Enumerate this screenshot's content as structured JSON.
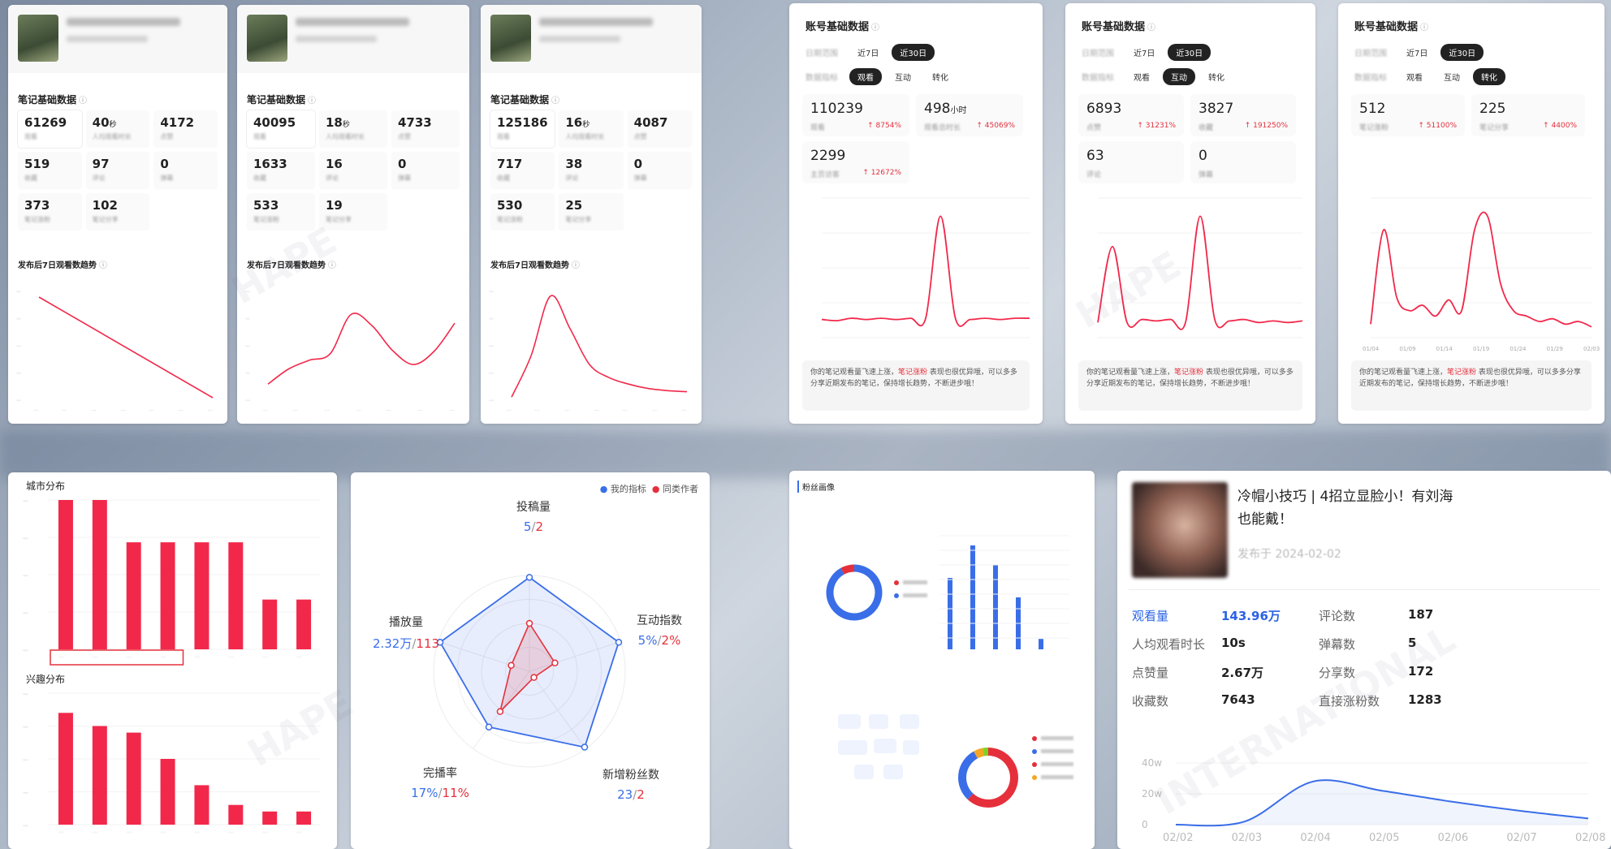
{
  "colors": {
    "accent_red": "#f2284a",
    "accent_blue": "#3a6ee8",
    "dark_pill": "#222222",
    "up_red": "#e5303c"
  },
  "watermark": {
    "line1": "HAPE",
    "line2": "INTERNATIONAL"
  },
  "note_cards": [
    {
      "section_title": "笔记基础数据",
      "metrics": [
        {
          "value": "61269",
          "unit": "",
          "label": "观看"
        },
        {
          "value": "40",
          "unit": "秒",
          "label": "人均观看时长"
        },
        {
          "value": "4172",
          "unit": "",
          "label": "点赞"
        },
        {
          "value": "519",
          "unit": "",
          "label": "收藏"
        },
        {
          "value": "97",
          "unit": "",
          "label": "评论"
        },
        {
          "value": "0",
          "unit": "",
          "label": "弹幕"
        },
        {
          "value": "373",
          "unit": "",
          "label": "笔记涨粉"
        },
        {
          "value": "102",
          "unit": "",
          "label": "笔记分享"
        }
      ],
      "trend_title": "发布后7日观看数趋势"
    },
    {
      "section_title": "笔记基础数据",
      "metrics": [
        {
          "value": "40095",
          "unit": "",
          "label": "观看"
        },
        {
          "value": "18",
          "unit": "秒",
          "label": "人均观看时长"
        },
        {
          "value": "4733",
          "unit": "",
          "label": "点赞"
        },
        {
          "value": "1633",
          "unit": "",
          "label": "收藏"
        },
        {
          "value": "16",
          "unit": "",
          "label": "评论"
        },
        {
          "value": "0",
          "unit": "",
          "label": "弹幕"
        },
        {
          "value": "533",
          "unit": "",
          "label": "笔记涨粉"
        },
        {
          "value": "19",
          "unit": "",
          "label": "笔记分享"
        }
      ],
      "trend_title": "发布后7日观看数趋势"
    },
    {
      "section_title": "笔记基础数据",
      "metrics": [
        {
          "value": "125186",
          "unit": "",
          "label": "观看"
        },
        {
          "value": "16",
          "unit": "秒",
          "label": "人均观看时长"
        },
        {
          "value": "4087",
          "unit": "",
          "label": "点赞"
        },
        {
          "value": "717",
          "unit": "",
          "label": "收藏"
        },
        {
          "value": "38",
          "unit": "",
          "label": "评论"
        },
        {
          "value": "0",
          "unit": "",
          "label": "弹幕"
        },
        {
          "value": "530",
          "unit": "",
          "label": "笔记涨粉"
        },
        {
          "value": "25",
          "unit": "",
          "label": "笔记分享"
        }
      ],
      "trend_title": "发布后7日观看数趋势"
    }
  ],
  "account_cards": [
    {
      "title": "账号基础数据",
      "date_label": "日期范围",
      "date_tabs": [
        "近7日",
        "近30日"
      ],
      "date_active": 1,
      "metric_label": "数据指标",
      "metric_tabs": [
        "观看",
        "互动",
        "转化"
      ],
      "metric_active": 0,
      "blocks": [
        {
          "value": "110239",
          "unit": "",
          "label": "观看",
          "change": "↑ 8754%"
        },
        {
          "value": "498",
          "unit": "小时",
          "label": "观看总时长",
          "change": "↑ 45069%"
        },
        {
          "value": "2299",
          "unit": "",
          "label": "主页访客",
          "change": "↑ 12672%"
        }
      ],
      "tip_pre": "你的笔记观看量飞速上涨，",
      "tip_hl": "笔记涨粉",
      "tip_post": " 表现也很优异哦，可以多多分享近期发布的笔记，保持增长趋势，不断进步哦！"
    },
    {
      "title": "账号基础数据",
      "date_label": "日期范围",
      "date_tabs": [
        "近7日",
        "近30日"
      ],
      "date_active": 1,
      "metric_label": "数据指标",
      "metric_tabs": [
        "观看",
        "互动",
        "转化"
      ],
      "metric_active": 1,
      "blocks": [
        {
          "value": "6893",
          "unit": "",
          "label": "点赞",
          "change": "↑ 31231%"
        },
        {
          "value": "3827",
          "unit": "",
          "label": "收藏",
          "change": "↑ 191250%"
        },
        {
          "value": "63",
          "unit": "",
          "label": "评论",
          "change": ""
        },
        {
          "value": "0",
          "unit": "",
          "label": "弹幕",
          "change": ""
        }
      ],
      "tip_pre": "你的笔记观看量飞速上涨，",
      "tip_hl": "笔记涨粉",
      "tip_post": " 表现也很优异哦，可以多多分享近期发布的笔记，保持增长趋势，不断进步哦！"
    },
    {
      "title": "账号基础数据",
      "date_label": "日期范围",
      "date_tabs": [
        "近7日",
        "近30日"
      ],
      "date_active": 1,
      "metric_label": "数据指标",
      "metric_tabs": [
        "观看",
        "互动",
        "转化"
      ],
      "metric_active": 2,
      "blocks": [
        {
          "value": "512",
          "unit": "",
          "label": "笔记涨粉",
          "change": "↑ 51100%"
        },
        {
          "value": "225",
          "unit": "",
          "label": "笔记分享",
          "change": "↑ 4400%"
        }
      ],
      "tip_pre": "你的笔记观看量飞速上涨，",
      "tip_hl": "笔记涨粉",
      "tip_post": " 表现也很优异哦，可以多多分享近期发布的笔记，保持增长趋势，不断进步哦！"
    }
  ],
  "distribution": {
    "city_title": "城市分布",
    "interest_title": "兴趣分布"
  },
  "radar": {
    "legend_mine": "我的指标",
    "legend_peer": "同类作者",
    "axes": [
      {
        "name": "投稿量",
        "mine": "5",
        "peer": "2"
      },
      {
        "name": "互动指数",
        "mine": "5%",
        "peer": "2%"
      },
      {
        "name": "新增粉丝数",
        "mine": "23",
        "peer": "2"
      },
      {
        "name": "完播率",
        "mine": "17%",
        "peer": "11%"
      },
      {
        "name": "播放量",
        "mine": "2.32万",
        "peer": "113"
      }
    ],
    "separator": "/"
  },
  "fan_portrait": {
    "title": "粉丝画像"
  },
  "video_card": {
    "title_line1": "冷帽小技巧 | 4招立显脸小！有刘海",
    "title_line2": "也能戴！",
    "publish": "发布于 2024-02-02",
    "stats": [
      {
        "k": "观看量",
        "v": "143.96万",
        "k2": "评论数",
        "v2": "187"
      },
      {
        "k": "人均观看时长",
        "v": "10s",
        "k2": "弹幕数",
        "v2": "5"
      },
      {
        "k": "点赞量",
        "v": "2.67万",
        "k2": "分享数",
        "v2": "172"
      },
      {
        "k": "收藏数",
        "v": "7643",
        "k2": "直接涨粉数",
        "v2": "1283"
      }
    ]
  },
  "chart_data": [
    {
      "type": "bar",
      "title": "城市分布",
      "categories": [
        "",
        "",
        "",
        "",
        "",
        "",
        "",
        ""
      ],
      "values": [
        3.0,
        3.0,
        2.15,
        2.15,
        2.15,
        2.15,
        1.0,
        1.0
      ],
      "ylim": [
        0,
        3.0
      ],
      "color": "#f2284a"
    },
    {
      "type": "bar",
      "title": "兴趣分布",
      "categories": [
        "",
        "",
        "",
        "",
        "",
        "",
        "",
        ""
      ],
      "values": [
        17,
        15,
        14,
        10,
        6,
        3,
        2,
        2
      ],
      "ylim": [
        0,
        20
      ],
      "color": "#f2284a"
    },
    {
      "type": "line",
      "title": "",
      "x": [
        2,
        4,
        6,
        8,
        10,
        12,
        14,
        16,
        18,
        20,
        22,
        24,
        26,
        28,
        30
      ],
      "y": [
        15,
        14,
        16,
        15,
        16,
        15,
        16,
        16,
        100,
        16,
        15,
        16,
        15,
        16,
        16
      ],
      "color": "#f2284a"
    },
    {
      "type": "line",
      "title": "",
      "x": [
        2,
        4,
        6,
        8,
        10,
        12,
        14,
        16,
        18,
        20,
        22,
        24,
        26,
        28,
        30
      ],
      "y": [
        10,
        60,
        10,
        12,
        11,
        12,
        10,
        80,
        12,
        11,
        12,
        10,
        11,
        10,
        11
      ],
      "color": "#f2284a"
    },
    {
      "type": "line",
      "title": "",
      "x": [
        "01/04",
        "01/09",
        "01/14",
        "01/19",
        "01/24",
        "01/29",
        "02/03"
      ],
      "y": [
        5,
        40,
        15,
        10,
        12,
        8,
        14,
        10,
        40,
        45,
        20,
        10,
        8,
        6,
        7,
        5,
        6,
        4
      ],
      "ylim": [
        0,
        60
      ],
      "color": "#f2284a"
    },
    {
      "type": "line",
      "title": "",
      "x": [
        "02/02",
        "02/03",
        "02/04",
        "02/05",
        "02/06",
        "02/07",
        "02/08"
      ],
      "y": [
        0,
        2,
        28,
        22,
        15,
        9,
        4
      ],
      "ylim": [
        0,
        40
      ],
      "yticks": [
        "0",
        "20w",
        "40w"
      ],
      "color": "#3a6ee8"
    }
  ]
}
